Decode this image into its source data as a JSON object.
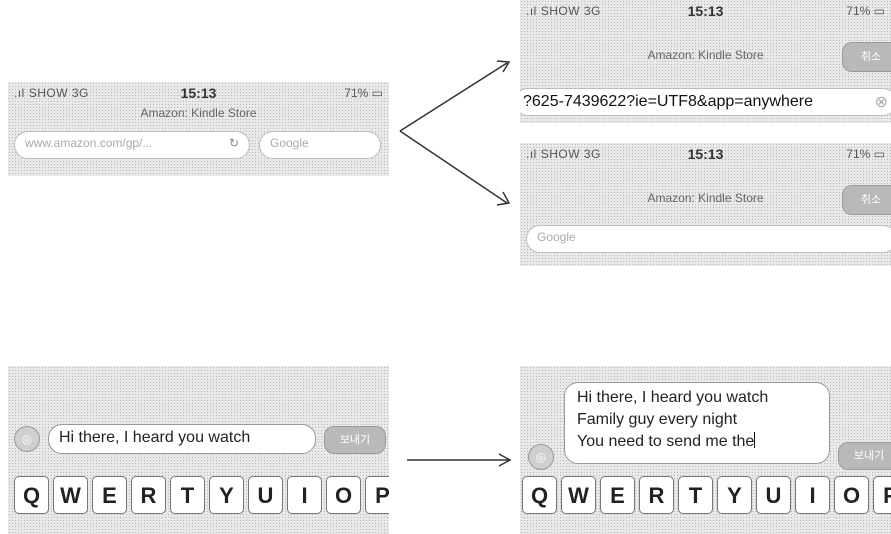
{
  "status": {
    "carrier": "SHOW",
    "network": "3G",
    "time": "15:13",
    "battery": "71%"
  },
  "browser": {
    "page_title": "Amazon: Kindle Store",
    "url_display": "www.amazon.com/gp/...",
    "url_editing": "?625-7439622?ie=UTF8&app=anywhere",
    "search_placeholder": "Google",
    "cancel_label": "취소"
  },
  "sms": {
    "single_line_text": "Hi there, I heard you watch",
    "multi_lines": [
      "Hi there, I heard you watch",
      "Family guy every night",
      "You need to send me the"
    ],
    "send_label": "보내기"
  },
  "keyboard": {
    "row1": [
      "Q",
      "W",
      "E",
      "R",
      "T",
      "Y",
      "U",
      "I",
      "O",
      "P"
    ]
  },
  "icons": {
    "reload": "reload-icon",
    "clear": "clear-icon",
    "camera": "camera-icon",
    "arrow": "arrow-icon"
  }
}
